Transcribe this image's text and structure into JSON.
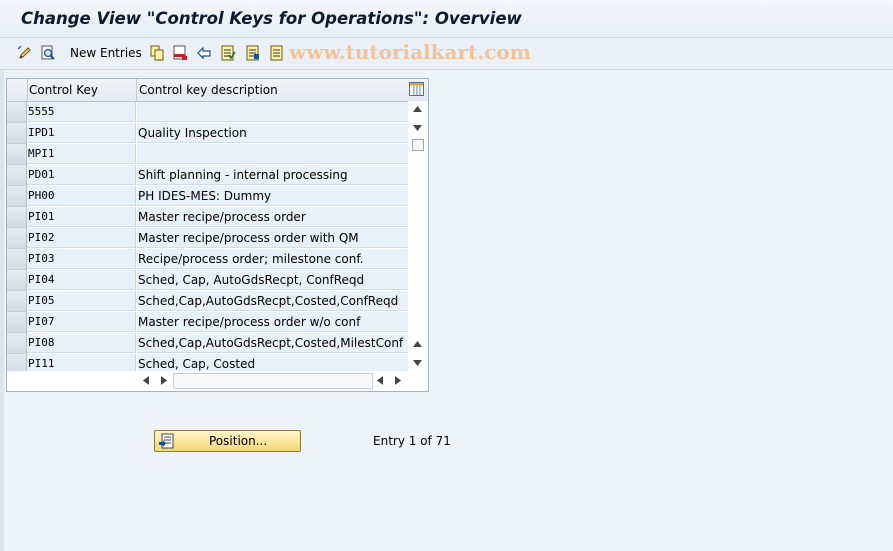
{
  "window": {
    "title": "Change View \"Control Keys for Operations\": Overview"
  },
  "toolbar": {
    "new_entries_label": "New Entries",
    "watermark": "www.tutorialkart.com"
  },
  "table": {
    "columns": [
      "Control Key",
      "Control key description"
    ],
    "rows": [
      {
        "key": "5555",
        "desc": ""
      },
      {
        "key": "IPD1",
        "desc": "Quality Inspection"
      },
      {
        "key": "MPI1",
        "desc": ""
      },
      {
        "key": "PD01",
        "desc": "Shift planning - internal processing"
      },
      {
        "key": "PH00",
        "desc": "PH IDES-MES: Dummy"
      },
      {
        "key": "PI01",
        "desc": "Master recipe/process order"
      },
      {
        "key": "PI02",
        "desc": "Master recipe/process order with QM"
      },
      {
        "key": "PI03",
        "desc": "Recipe/process order; milestone conf."
      },
      {
        "key": "PI04",
        "desc": "Sched, Cap, AutoGdsRecpt, ConfReqd"
      },
      {
        "key": "PI05",
        "desc": "Sched,Cap,AutoGdsRecpt,Costed,ConfReqd"
      },
      {
        "key": "PI07",
        "desc": "Master recipe/process order w/o conf"
      },
      {
        "key": "PI08",
        "desc": "Sched,Cap,AutoGdsRecpt,Costed,MilestConf"
      },
      {
        "key": "PI11",
        "desc": "Sched, Cap, Costed"
      }
    ]
  },
  "footer": {
    "position_label": "Position...",
    "entry_info": "Entry 1 of 71"
  },
  "icons": [
    "edit-pencil-icon",
    "find-icon",
    "copy-icon",
    "delete-icon",
    "undo-icon",
    "select-all-icon",
    "select-block-icon",
    "deselect-icon",
    "column-settings-icon",
    "position-icon"
  ]
}
